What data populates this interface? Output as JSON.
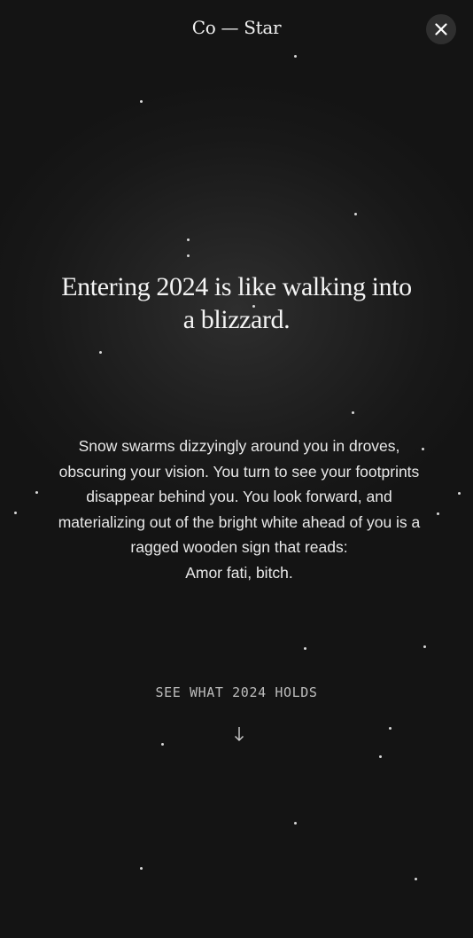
{
  "header": {
    "brand": "Co — Star",
    "close_icon": "close-icon"
  },
  "main": {
    "headline_lines": [
      "Entering 2024 is like walking into",
      "a blizzard."
    ],
    "body_lines": [
      "Snow swarms dizzyingly around you in droves,",
      "obscuring your vision. You turn to see your footprints",
      "disappear behind you. You look forward, and",
      "materializing out of the bright white ahead of you is a",
      "ragged wooden sign that reads:",
      "Amor fati, bitch."
    ],
    "cta_label": "SEE WHAT 2024 HOLDS",
    "arrow_icon": "arrow-down-icon"
  },
  "colors": {
    "background": "#141414",
    "text": "#f4f4f4",
    "muted_text": "#bdbdbd",
    "close_button_bg": "#2f2f2f"
  }
}
